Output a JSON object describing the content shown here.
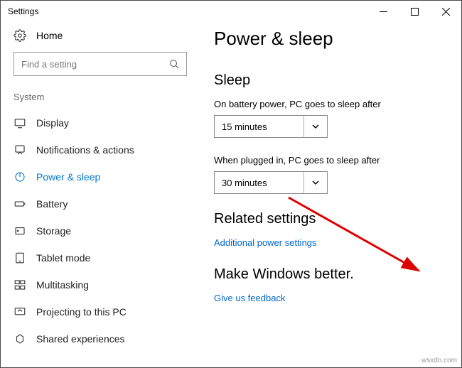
{
  "window": {
    "title": "Settings"
  },
  "sidebar": {
    "home": "Home",
    "search_placeholder": "Find a setting",
    "group": "System",
    "items": [
      {
        "label": "Display"
      },
      {
        "label": "Notifications & actions"
      },
      {
        "label": "Power & sleep"
      },
      {
        "label": "Battery"
      },
      {
        "label": "Storage"
      },
      {
        "label": "Tablet mode"
      },
      {
        "label": "Multitasking"
      },
      {
        "label": "Projecting to this PC"
      },
      {
        "label": "Shared experiences"
      }
    ]
  },
  "content": {
    "title": "Power & sleep",
    "sleep": {
      "heading": "Sleep",
      "battery_label": "On battery power, PC goes to sleep after",
      "battery_value": "15 minutes",
      "plugged_label": "When plugged in, PC goes to sleep after",
      "plugged_value": "30 minutes"
    },
    "related": {
      "heading": "Related settings",
      "link": "Additional power settings"
    },
    "better": {
      "heading": "Make Windows better.",
      "link": "Give us feedback"
    }
  },
  "watermark": "wsxdn.com"
}
